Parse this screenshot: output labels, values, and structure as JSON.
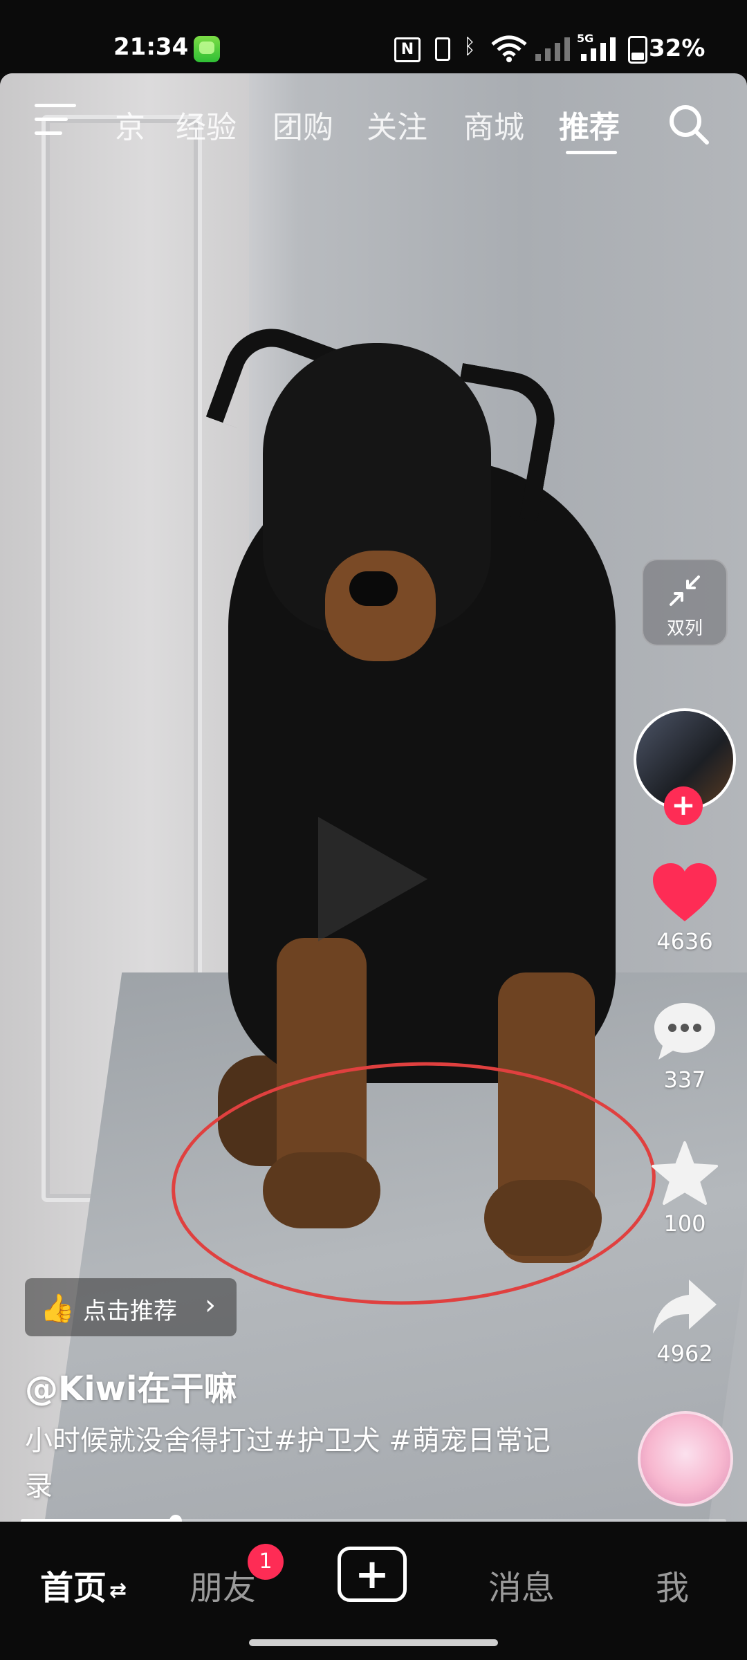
{
  "status_bar": {
    "time": "21:34",
    "nfc_label": "N",
    "network_label": "5G",
    "battery_percent": "32%",
    "battery_level": 0.32
  },
  "top_nav": {
    "tabs": [
      {
        "label": "京"
      },
      {
        "label": "经验"
      },
      {
        "label": "团购"
      },
      {
        "label": "关注"
      },
      {
        "label": "商城"
      },
      {
        "label": "推荐"
      }
    ],
    "active_tab": "推荐",
    "icons": {
      "menu": "menu-icon",
      "search": "search-icon"
    }
  },
  "video": {
    "dual_column_label": "双列",
    "play_icon": "play-icon"
  },
  "actions": {
    "likes": "4636",
    "comments": "337",
    "favorites": "100",
    "shares": "4962",
    "follow_symbol": "+"
  },
  "post": {
    "recommend_label": "点击推荐",
    "author": "@Kiwi在干嘛",
    "caption": "小时候就没舍得打过#护卫犬 #萌宠日常记录"
  },
  "progress": {
    "value": 0.22
  },
  "bottom_nav": {
    "items": [
      {
        "label": "首页"
      },
      {
        "label": "朋友"
      },
      {
        "label": "消息"
      },
      {
        "label": "我"
      }
    ],
    "friend_badge": "1",
    "active": "首页",
    "create_symbol": "+"
  },
  "colors": {
    "accent": "#fe2c55",
    "annotation": "#e0403f"
  }
}
